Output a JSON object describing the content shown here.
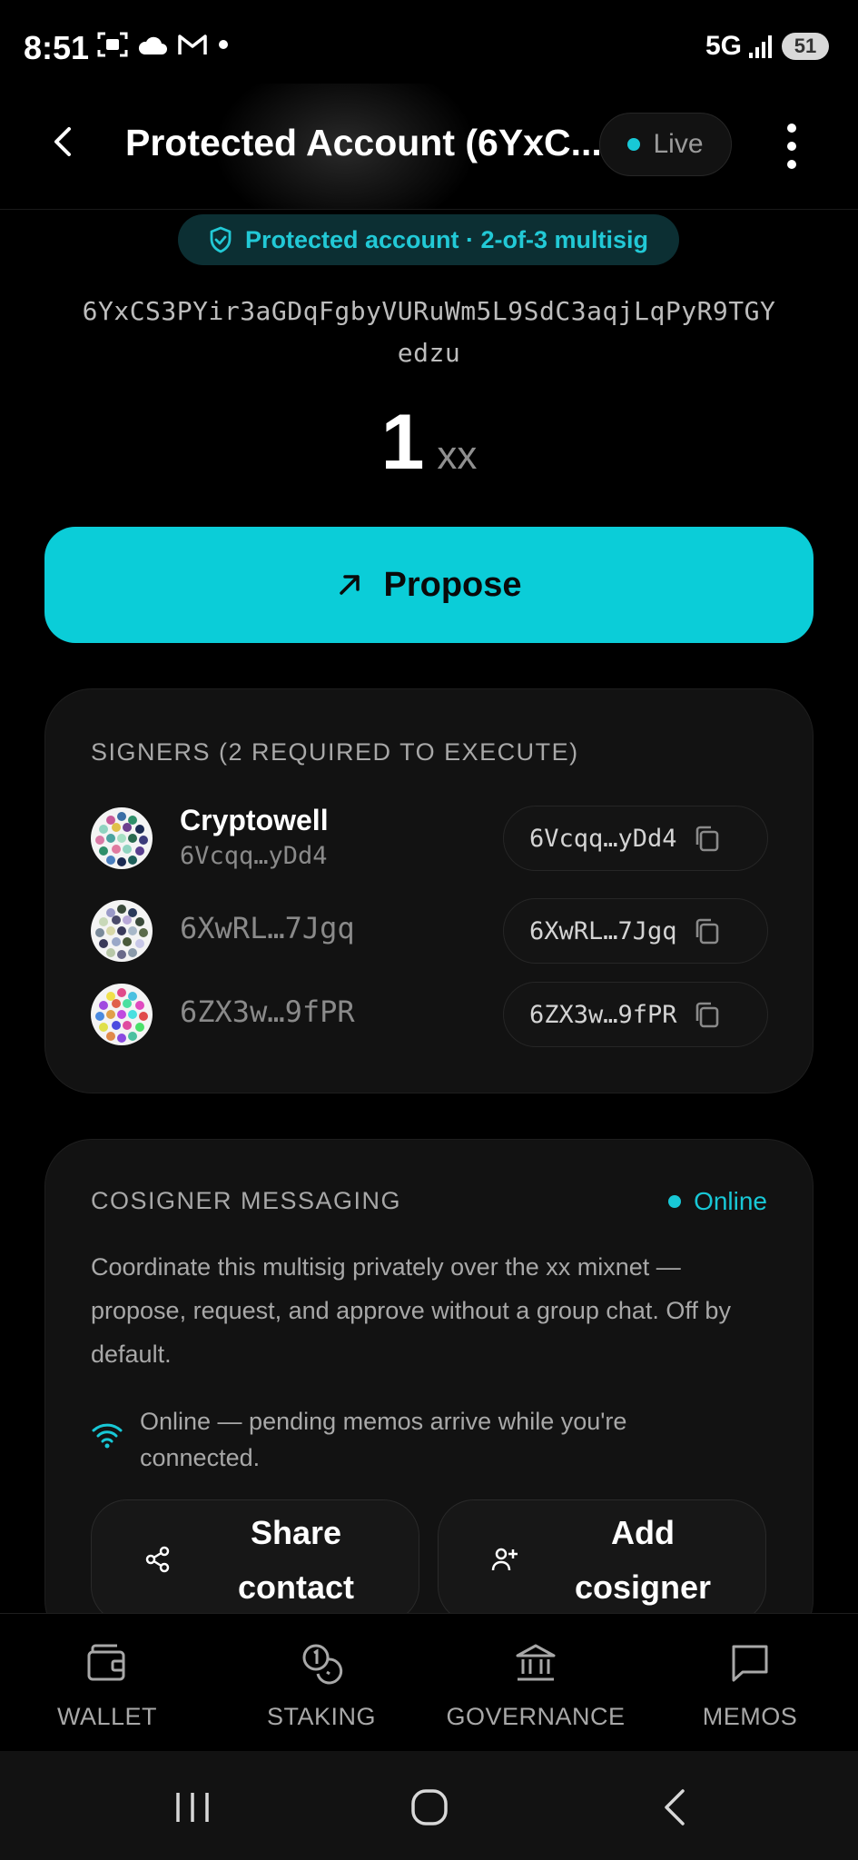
{
  "status_bar": {
    "time": "8:51",
    "network": "5G",
    "battery": "51"
  },
  "header": {
    "title": "Protected Account (6YxC...",
    "live_label": "Live"
  },
  "badge": {
    "text": "Protected account · 2-of-3 multisig"
  },
  "account": {
    "address_line1": "6YxCS3PYir3aGDqFgbyVURuWm5L9SdC3aqjLqPyR9TGY",
    "address_line2": "edzu",
    "balance": "1",
    "unit": "xx"
  },
  "propose_button": {
    "label": "Propose"
  },
  "signers": {
    "title": "SIGNERS (2 REQUIRED TO EXECUTE)",
    "items": [
      {
        "name": "Cryptowell",
        "address": "6Vcqq…yDd4",
        "chip": "6Vcqq…yDd4"
      },
      {
        "name": "",
        "address": "6XwRL…7Jgq",
        "chip": "6XwRL…7Jgq"
      },
      {
        "name": "",
        "address": "6ZX3w…9fPR",
        "chip": "6ZX3w…9fPR"
      }
    ]
  },
  "messaging": {
    "title": "COSIGNER MESSAGING",
    "status": "Online",
    "description": "Coordinate this multisig privately over the xx mixnet — propose, request, and approve without a group chat. Off by default.",
    "online_note": "Online — pending memos arrive while you're connected.",
    "share_label": "Share contact",
    "add_label": "Add cosigner"
  },
  "bottom_nav": {
    "wallet": "WALLET",
    "staking": "STAKING",
    "governance": "GOVERNANCE",
    "memos": "MEMOS"
  },
  "colors": {
    "accent": "#0bcdd8",
    "background": "#000000",
    "card": "#121212"
  }
}
